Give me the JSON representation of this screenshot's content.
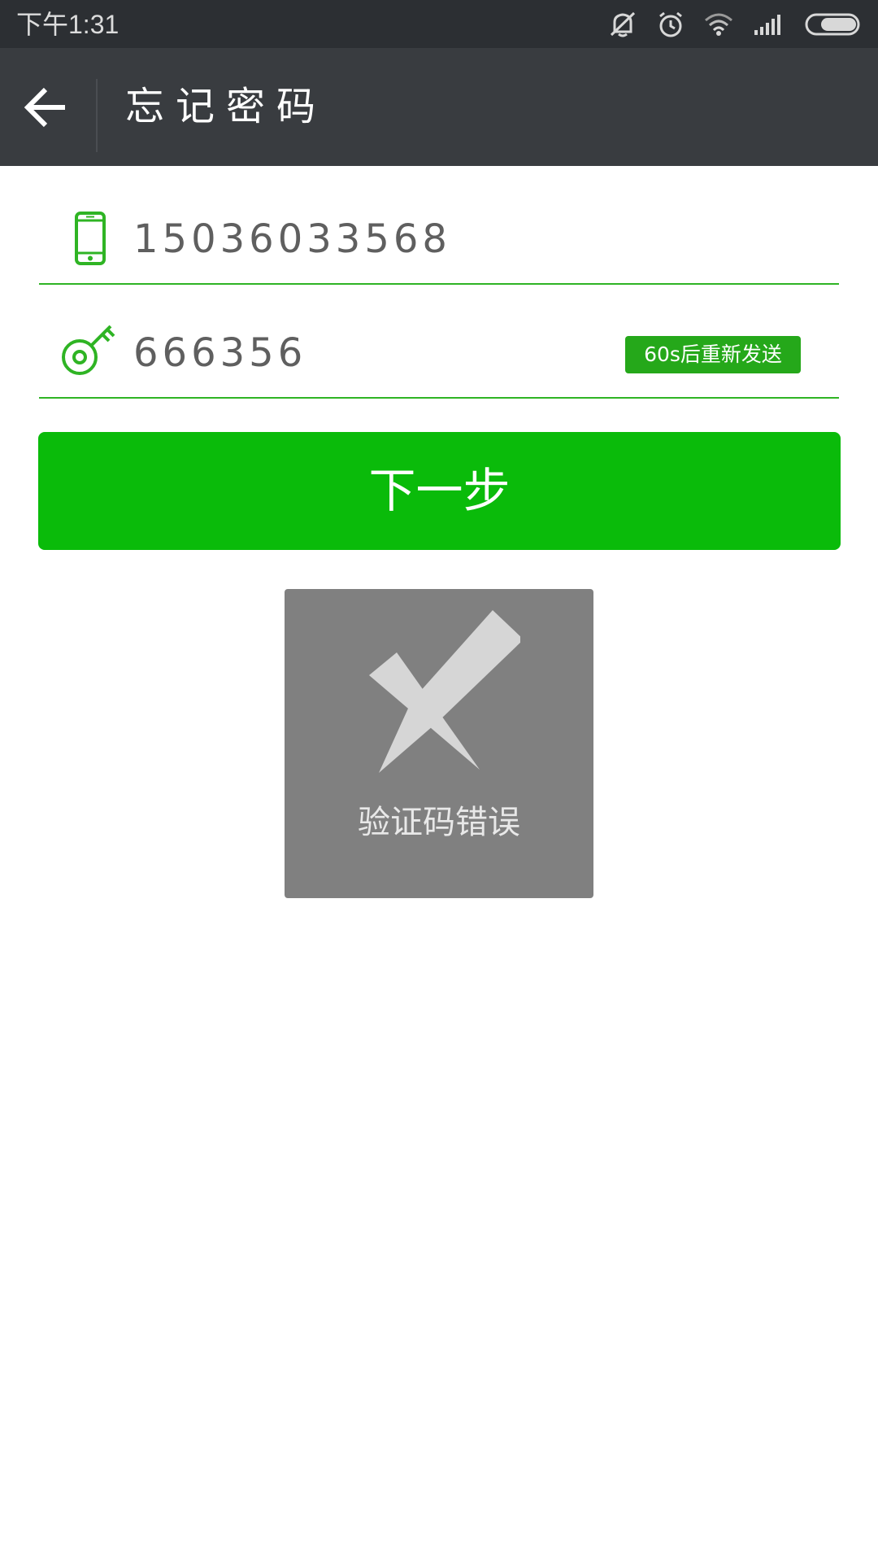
{
  "status_bar": {
    "time": "下午1:31",
    "icons": [
      "vibrate-off-icon",
      "alarm-icon",
      "wifi-icon",
      "signal-icon",
      "battery-icon"
    ]
  },
  "app_bar": {
    "back_icon": "arrow-left-icon",
    "title": "忘记密码"
  },
  "form": {
    "phone": {
      "icon": "phone-icon",
      "value": "15036033568"
    },
    "code": {
      "icon": "key-icon",
      "value": "666356",
      "resend_label": "60s后重新发送"
    },
    "next_label": "下一步"
  },
  "toast": {
    "icon": "error-x-icon",
    "message": "验证码错误"
  },
  "colors": {
    "status_bar": "#2c2f33",
    "app_bar": "#393c40",
    "accent_green": "#0abb0a",
    "field_line": "#2fb424",
    "toast_bg": "#808080"
  }
}
